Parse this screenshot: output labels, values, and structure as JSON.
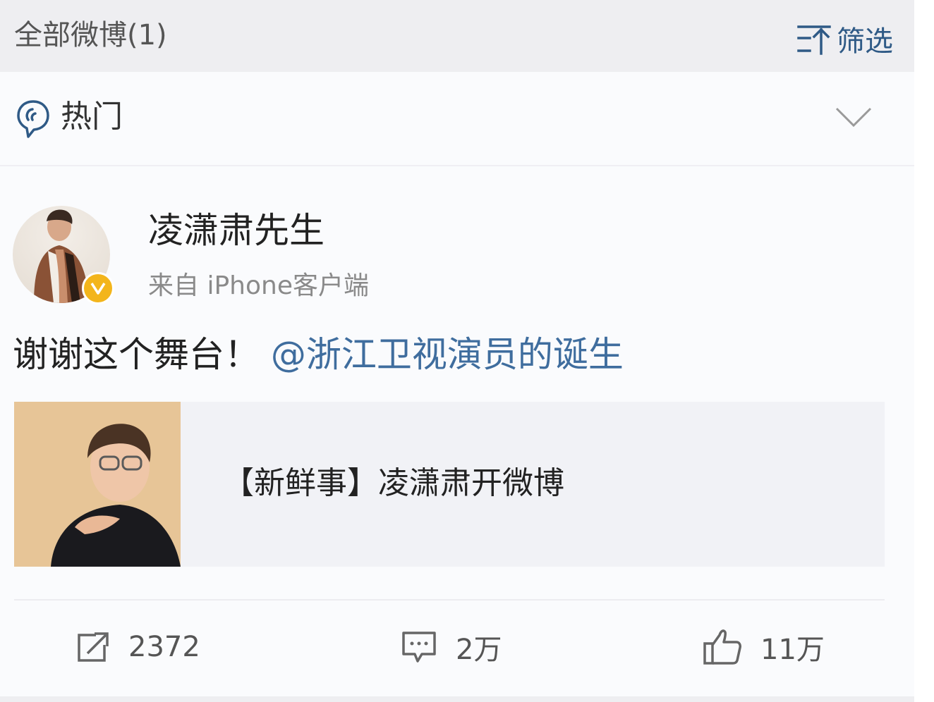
{
  "header": {
    "title": "全部微博(1)",
    "filter_label": "筛选"
  },
  "section": {
    "label": "热门"
  },
  "post": {
    "user_name": "凌潇肃先生",
    "source": "来自 iPhone客户端",
    "text": "谢谢这个舞台！",
    "mention": "@浙江卫视演员的诞生",
    "link_card": {
      "title": "【新鲜事】凌潇肃开微博"
    },
    "actions": {
      "repost": "2372",
      "comment": "2万",
      "like": "11万"
    }
  },
  "colors": {
    "link": "#3f6d9e",
    "verified_badge": "#f3b51b",
    "header_bg": "#eeeef1"
  },
  "icons": [
    "filter-icon",
    "hot-icon",
    "chevron-down-icon",
    "verified-icon",
    "repost-icon",
    "comment-icon",
    "like-icon"
  ]
}
